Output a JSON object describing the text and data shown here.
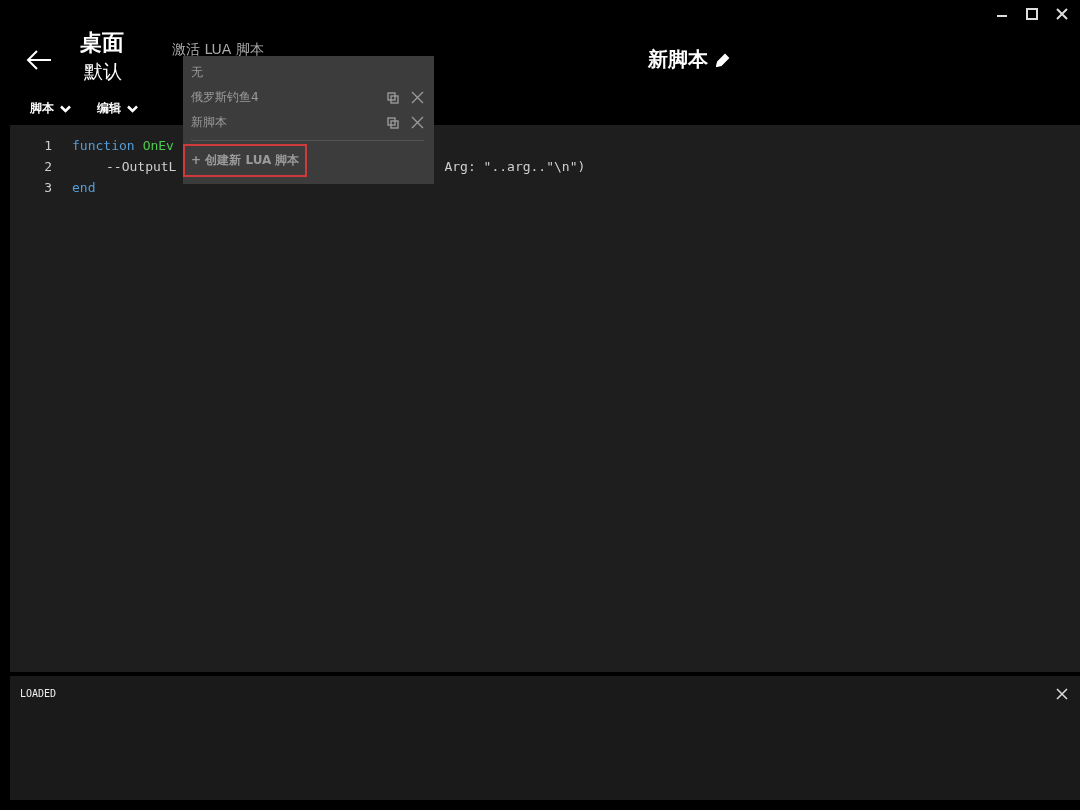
{
  "header": {
    "title": "桌面",
    "subtitle": "默认",
    "activate_label": "激活 LUA 脚本",
    "script_name": "新脚本"
  },
  "menus": [
    {
      "label": "脚本"
    },
    {
      "label": "编辑"
    }
  ],
  "dropdown": {
    "items": [
      {
        "kind": "none",
        "label": "无"
      },
      {
        "kind": "script",
        "label": "俄罗斯钓鱼4"
      },
      {
        "kind": "script",
        "label": "新脚本"
      },
      {
        "kind": "create",
        "label": "+ 创建新 LUA 脚本",
        "highlighted": true
      }
    ]
  },
  "editor": {
    "lines": [
      {
        "number": "1",
        "parts": [
          {
            "kind": "keyword",
            "text": "function"
          },
          {
            "kind": "name",
            "text": "OnEv"
          }
        ]
      },
      {
        "number": "2",
        "parts": [
          {
            "kind": "plain",
            "text": "--OutputL"
          },
          {
            "kind": "hidden_gap"
          },
          {
            "kind": "plain",
            "text": "Arg: \"..arg..\"\\n\")"
          }
        ]
      },
      {
        "number": "3",
        "parts": [
          {
            "kind": "keyword",
            "text": "end"
          }
        ]
      }
    ]
  },
  "output": {
    "text": "LOADED"
  }
}
